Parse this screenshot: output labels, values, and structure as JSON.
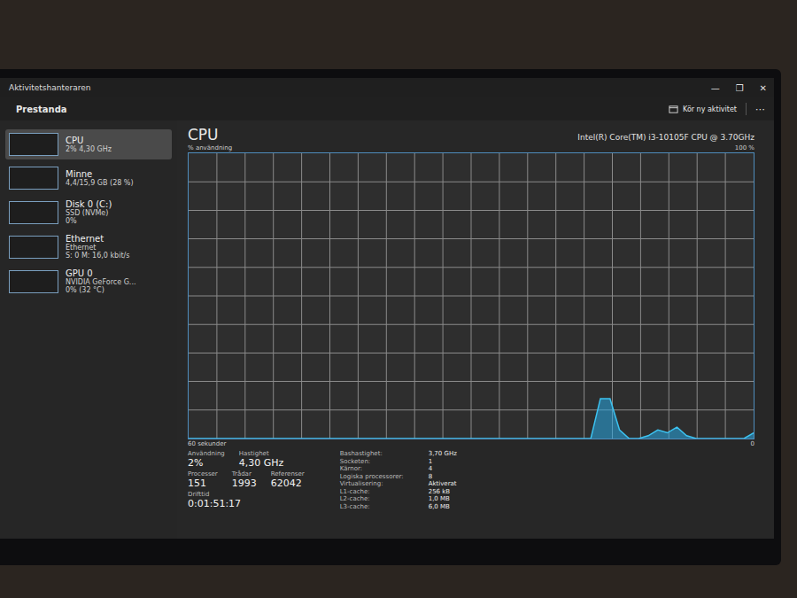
{
  "window": {
    "title": "Aktivitetshanteraren",
    "controls": [
      "—",
      "❐",
      "✕"
    ]
  },
  "header": {
    "title": "Prestanda",
    "run_task": "Kör ny aktivitet",
    "more": "⋯"
  },
  "sidebar": {
    "items": [
      {
        "name": "CPU",
        "lines": [
          "2% 4,30 GHz"
        ],
        "selected": true
      },
      {
        "name": "Minne",
        "lines": [
          "4,4/15,9 GB (28 %)"
        ],
        "selected": false
      },
      {
        "name": "Disk 0 (C:)",
        "lines": [
          "SSD (NVMe)",
          "0%"
        ],
        "selected": false
      },
      {
        "name": "Ethernet",
        "lines": [
          "Ethernet",
          "S: 0 M: 16,0 kbit/s"
        ],
        "selected": false
      },
      {
        "name": "GPU 0",
        "lines": [
          "NVIDIA GeForce G...",
          "0% (32 °C)"
        ],
        "selected": false
      }
    ]
  },
  "cpu": {
    "title": "CPU",
    "model": "Intel(R) Core(TM) i3-10105F CPU @ 3.70GHz",
    "axis_label": "% användning",
    "axis_max": "100 %",
    "time_label": "60 sekunder",
    "axis_min": "0",
    "series": [
      0,
      0,
      0,
      0,
      0,
      0,
      0,
      0,
      0,
      0,
      0,
      0,
      0,
      0,
      0,
      0,
      0,
      0,
      0,
      0,
      0,
      0,
      0,
      0,
      0,
      0,
      0,
      0,
      0,
      0,
      0,
      0,
      0,
      0,
      0,
      0,
      0,
      0,
      0,
      0,
      0,
      0,
      0,
      14,
      14,
      3,
      0,
      0,
      1,
      3,
      2,
      4,
      1,
      0,
      0,
      0,
      0,
      0,
      0,
      2
    ]
  },
  "stats": {
    "primary": [
      [
        {
          "label": "Användning",
          "value": "2%"
        },
        {
          "label": "Hastighet",
          "value": "4,30 GHz"
        }
      ],
      [
        {
          "label": "Processer",
          "value": "151"
        },
        {
          "label": "Trådar",
          "value": "1993"
        },
        {
          "label": "Referenser",
          "value": "62042"
        }
      ],
      [
        {
          "label": "Drifttid",
          "value": "0:01:51:17"
        }
      ]
    ],
    "specs": [
      {
        "label": "Bashastighet:",
        "value": "3,70 GHz"
      },
      {
        "label": "Socketen:",
        "value": "1"
      },
      {
        "label": "Kärnor:",
        "value": "4"
      },
      {
        "label": "Logiska processorer:",
        "value": "8"
      },
      {
        "label": "Virtualisering:",
        "value": "Aktiverat"
      },
      {
        "label": "L1-cache:",
        "value": "256 kB"
      },
      {
        "label": "L2-cache:",
        "value": "1,0 MB"
      },
      {
        "label": "L3-cache:",
        "value": "6,0 MB"
      }
    ]
  }
}
